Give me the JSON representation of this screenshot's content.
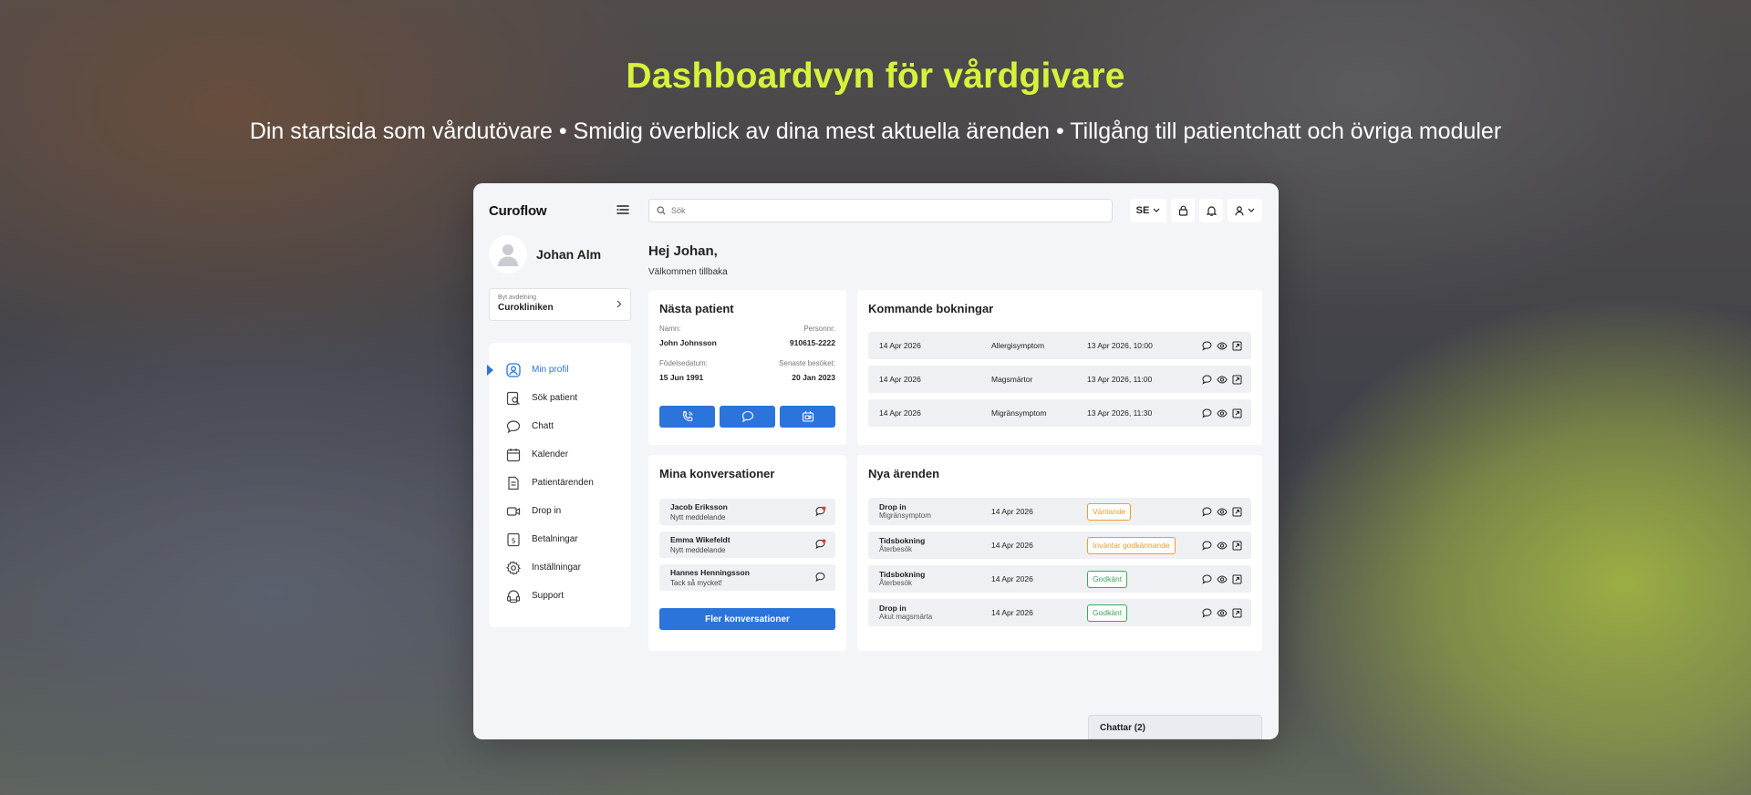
{
  "hero": {
    "title": "Dashboardvyn för vårdgivare",
    "subtitle": "Din startsida som vårdutövare • Smidig överblick av dina mest aktuella ärenden • Tillgång till patientchatt och övriga moduler"
  },
  "colors": {
    "accent": "#2a74db",
    "hero_title": "#d7f23a",
    "waiting": "#f29b2d",
    "approved": "#3aa85a",
    "unread_dot": "#e03a3a"
  },
  "app": {
    "logo": "Curoflow",
    "search_placeholder": "Sök",
    "language": "SE"
  },
  "sidebar": {
    "user_name": "Johan Alm",
    "dept_label": "Byt avdelning",
    "dept_name": "Curokliniken",
    "items": [
      {
        "label": "Min profil",
        "icon": "user-circle-icon",
        "active": true
      },
      {
        "label": "Sök patient",
        "icon": "search-patient-icon"
      },
      {
        "label": "Chatt",
        "icon": "chat-icon"
      },
      {
        "label": "Kalender",
        "icon": "calendar-icon"
      },
      {
        "label": "Patientärenden",
        "icon": "case-icon"
      },
      {
        "label": "Drop in",
        "icon": "drop-in-icon"
      },
      {
        "label": "Betalningar",
        "icon": "payment-icon"
      },
      {
        "label": "Inställningar",
        "icon": "gear-icon"
      },
      {
        "label": "Support",
        "icon": "support-icon"
      }
    ]
  },
  "main": {
    "greeting": "Hej Johan,",
    "welcome": "Välkommen tillbaka",
    "next_patient": {
      "title": "Nästa patient",
      "name_label": "Namn:",
      "name": "John Johnsson",
      "pnr_label": "Personnr:",
      "pnr": "910615-2222",
      "dob_label": "Födelsedatum:",
      "dob": "15 Jun 1991",
      "last_visit_label": "Senaste besöket:",
      "last_visit": "20 Jan 2023"
    },
    "bookings": {
      "title": "Kommande bokningar",
      "rows": [
        {
          "date": "14 Apr 2026",
          "reason": "Allergisymptom",
          "time": "13 Apr 2026, 10:00"
        },
        {
          "date": "14 Apr 2026",
          "reason": "Magsmärtor",
          "time": "13 Apr 2026, 11:00"
        },
        {
          "date": "14 Apr 2026",
          "reason": "Migränsymptom",
          "time": "13 Apr 2026, 11:30"
        }
      ]
    },
    "conversations": {
      "title": "Mina konversationer",
      "items": [
        {
          "name": "Jacob Eriksson",
          "message": "Nytt meddelande",
          "unread": true
        },
        {
          "name": "Emma Wikefeldt",
          "message": "Nytt meddelande",
          "unread": true
        },
        {
          "name": "Hannes Henningsson",
          "message": "Tack så mycket!",
          "unread": false
        }
      ],
      "more_button": "Fler konversationer"
    },
    "new_cases": {
      "title": "Nya ärenden",
      "rows": [
        {
          "type": "Drop in",
          "reason": "Migränsymptom",
          "date": "14 Apr 2026",
          "status": "Väntande",
          "status_kind": "wait"
        },
        {
          "type": "Tidsbokning",
          "reason": "Återbesök",
          "date": "14 Apr 2026",
          "status": "Inväntar godkännande",
          "status_kind": "wait"
        },
        {
          "type": "Tidsbokning",
          "reason": "Återbesök",
          "date": "14 Apr 2026",
          "status": "Godkänt",
          "status_kind": "ok"
        },
        {
          "type": "Drop in",
          "reason": "Akut magsmärta",
          "date": "14 Apr 2026",
          "status": "Godkänt",
          "status_kind": "ok"
        }
      ]
    },
    "chat_bar": "Chattar (2)"
  }
}
